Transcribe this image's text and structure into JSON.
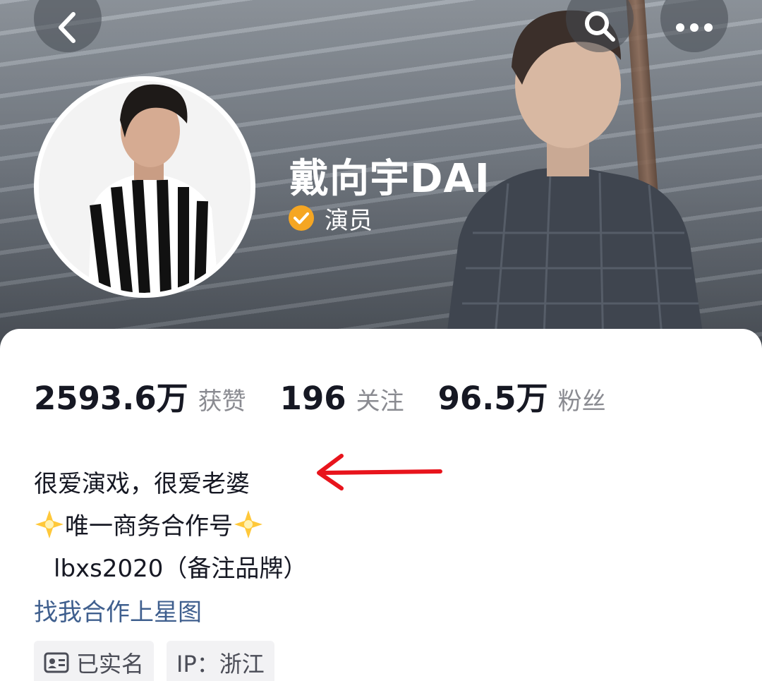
{
  "header": {
    "back_icon": "chevron-left-icon",
    "search_icon": "search-icon",
    "more_icon": "more-dots-icon"
  },
  "profile": {
    "name": "戴向宇DAI",
    "verify_icon": "verified-check-icon",
    "verify_label": "演员"
  },
  "stats": [
    {
      "value": "2593.6万",
      "label": "获赞"
    },
    {
      "value": "196",
      "label": "关注"
    },
    {
      "value": "96.5万",
      "label": "粉丝"
    }
  ],
  "bio": {
    "line1": "很爱演戏，很爱老婆",
    "line2_text": "唯一商务合作号",
    "line3": "lbxs2020（备注品牌）",
    "link": "找我合作上星图"
  },
  "tags": {
    "realname": "已实名",
    "ip": "IP：浙江"
  },
  "colors": {
    "verify_badge": "#f5a623",
    "arrow": "#e8141c",
    "link": "#3f5f8e"
  }
}
